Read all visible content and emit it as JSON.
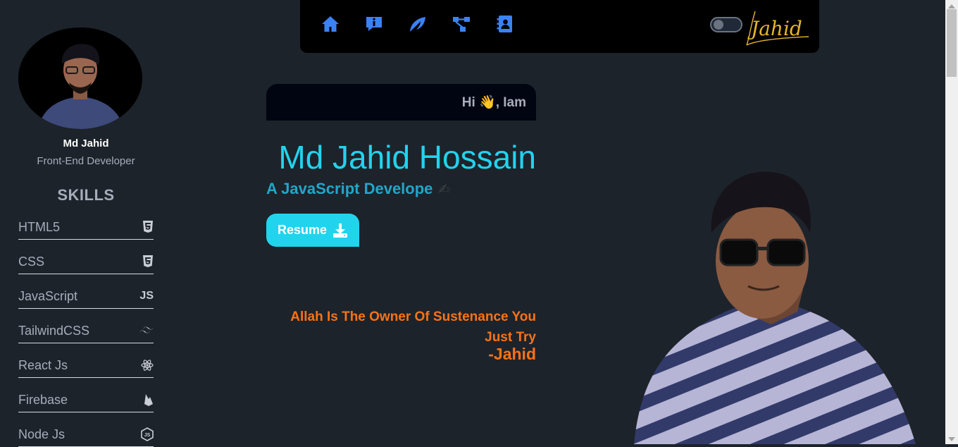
{
  "profile": {
    "name": "Md Jahid",
    "role": "Front-End Developer"
  },
  "skills": {
    "title": "SKILLS",
    "items": [
      {
        "label": "HTML5",
        "icon": "html5-icon"
      },
      {
        "label": "CSS",
        "icon": "css3-icon"
      },
      {
        "label": "JavaScript",
        "icon": "js-icon",
        "icon_text": "JS"
      },
      {
        "label": "TailwindCSS",
        "icon": "tailwind-icon"
      },
      {
        "label": "React Js",
        "icon": "react-icon"
      },
      {
        "label": "Firebase",
        "icon": "firebase-icon"
      },
      {
        "label": "Node Js",
        "icon": "nodejs-icon"
      }
    ]
  },
  "nav": {
    "items": [
      {
        "name": "home-icon"
      },
      {
        "name": "info-icon"
      },
      {
        "name": "services-icon"
      },
      {
        "name": "projects-icon"
      },
      {
        "name": "contact-icon"
      }
    ],
    "signature_text": "Jahid",
    "accent_color": "#3b82f6"
  },
  "hero": {
    "greeting": "Hi 👋, Iam",
    "name": "Md Jahid Hossain",
    "tagline": "A JavaScript Develope",
    "tagline_icon": "✍",
    "resume_label": "Resume",
    "quote": "Allah Is The Owner Of Sustenance You Just Try",
    "quote_author": "-Jahid"
  },
  "colors": {
    "background": "#1d232a",
    "cyan": "#22d3ee",
    "orange": "#f97316"
  }
}
